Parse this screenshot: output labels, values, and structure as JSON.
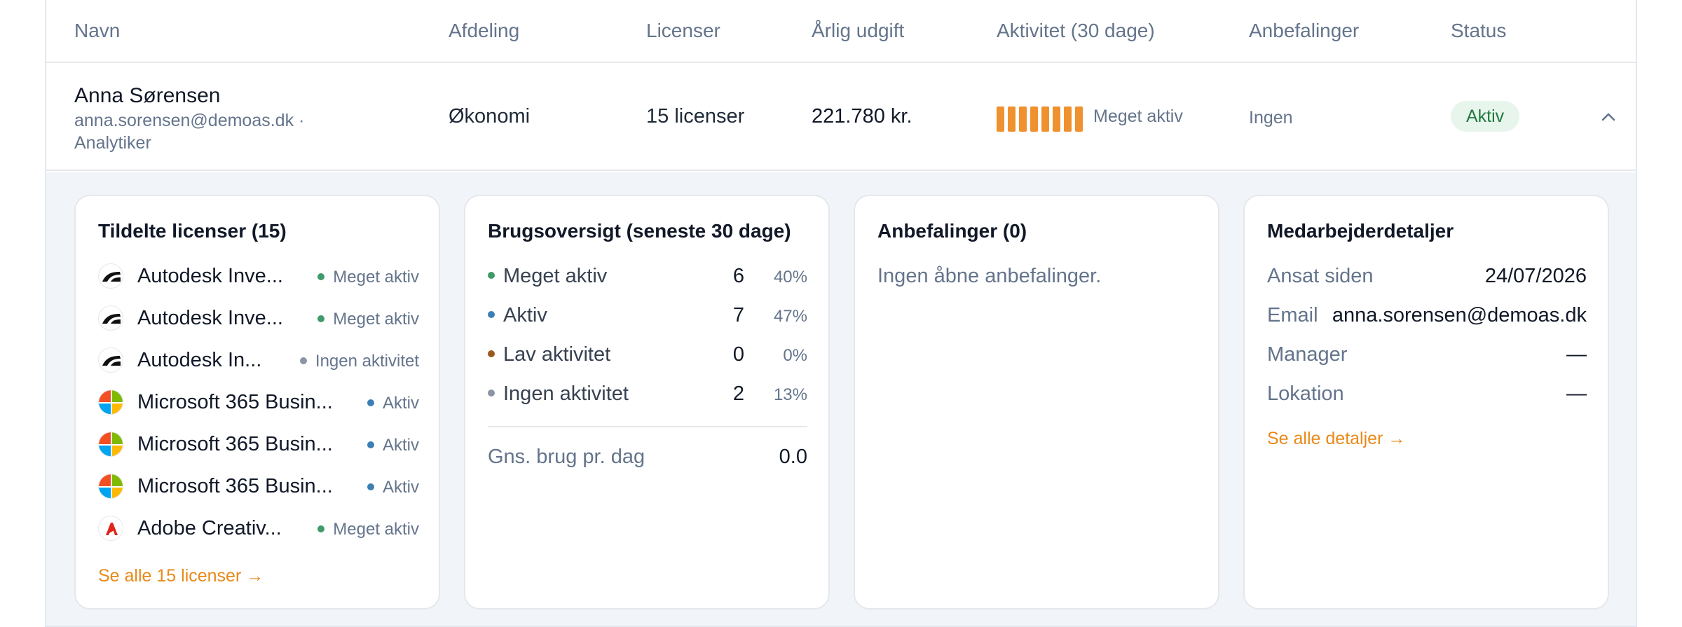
{
  "header": {
    "name": "Navn",
    "department": "Afdeling",
    "licenses": "Licenser",
    "annual_cost": "Årlig udgift",
    "activity": "Aktivitet (30 dage)",
    "recommendations": "Anbefalinger",
    "status": "Status"
  },
  "employee": {
    "name": "Anna Sørensen",
    "sub": "anna.sorensen@demoas.dk · Analytiker",
    "department": "Økonomi",
    "licenses": "15 licenser",
    "annual_cost": "221.780 kr.",
    "activity_level": 8,
    "activity_max": 8,
    "activity_label": "Meget aktiv",
    "recommendations": "Ingen",
    "status": "Aktiv"
  },
  "licenses_card": {
    "title": "Tildelte licenser (15)",
    "items": [
      {
        "name": "Autodesk Inve...",
        "status": "Meget aktiv",
        "dot_color": "#3f9b6b",
        "logo": "autodesk-icon"
      },
      {
        "name": "Autodesk Inve...",
        "status": "Meget aktiv",
        "dot_color": "#3f9b6b",
        "logo": "autodesk-icon"
      },
      {
        "name": "Autodesk In...",
        "status": "Ingen aktivitet",
        "dot_color": "#8b95a5",
        "logo": "autodesk-icon"
      },
      {
        "name": "Microsoft 365 Busin...",
        "status": "Aktiv",
        "dot_color": "#3b7fb5",
        "logo": "microsoft-icon"
      },
      {
        "name": "Microsoft 365 Busin...",
        "status": "Aktiv",
        "dot_color": "#3b7fb5",
        "logo": "microsoft-icon"
      },
      {
        "name": "Microsoft 365 Busin...",
        "status": "Aktiv",
        "dot_color": "#3b7fb5",
        "logo": "microsoft-icon"
      },
      {
        "name": "Adobe Creativ...",
        "status": "Meget aktiv",
        "dot_color": "#3f9b6b",
        "logo": "adobe-icon"
      }
    ],
    "link": "Se alle 15 licenser →"
  },
  "usage_card": {
    "title": "Brugsoversigt (seneste 30 dage)",
    "rows": [
      {
        "label": "Meget aktiv",
        "count": "6",
        "pct": "40%",
        "dot_color": "#3f9b6b"
      },
      {
        "label": "Aktiv",
        "count": "7",
        "pct": "47%",
        "dot_color": "#3b7fb5"
      },
      {
        "label": "Lav aktivitet",
        "count": "0",
        "pct": "0%",
        "dot_color": "#9a5a1e"
      },
      {
        "label": "Ingen aktivitet",
        "count": "2",
        "pct": "13%",
        "dot_color": "#8b95a5"
      }
    ],
    "avg_label": "Gns. brug pr. dag",
    "avg_value": "0.0"
  },
  "recommendations_card": {
    "title": "Anbefalinger (0)",
    "empty": "Ingen åbne anbefalinger."
  },
  "details_card": {
    "title": "Medarbejderdetaljer",
    "rows": [
      {
        "label": "Ansat siden",
        "value": "24/07/2026"
      },
      {
        "label": "Email",
        "value": "anna.sorensen@demoas.dk"
      },
      {
        "label": "Manager",
        "value": "—"
      },
      {
        "label": "Lokation",
        "value": "—"
      }
    ],
    "link": "Se alle detaljer →"
  },
  "colors": {
    "accent": "#e9891a",
    "activity_bar": "#f0912f",
    "status_bg": "#e8f5ec",
    "status_text": "#1f7a3f"
  }
}
